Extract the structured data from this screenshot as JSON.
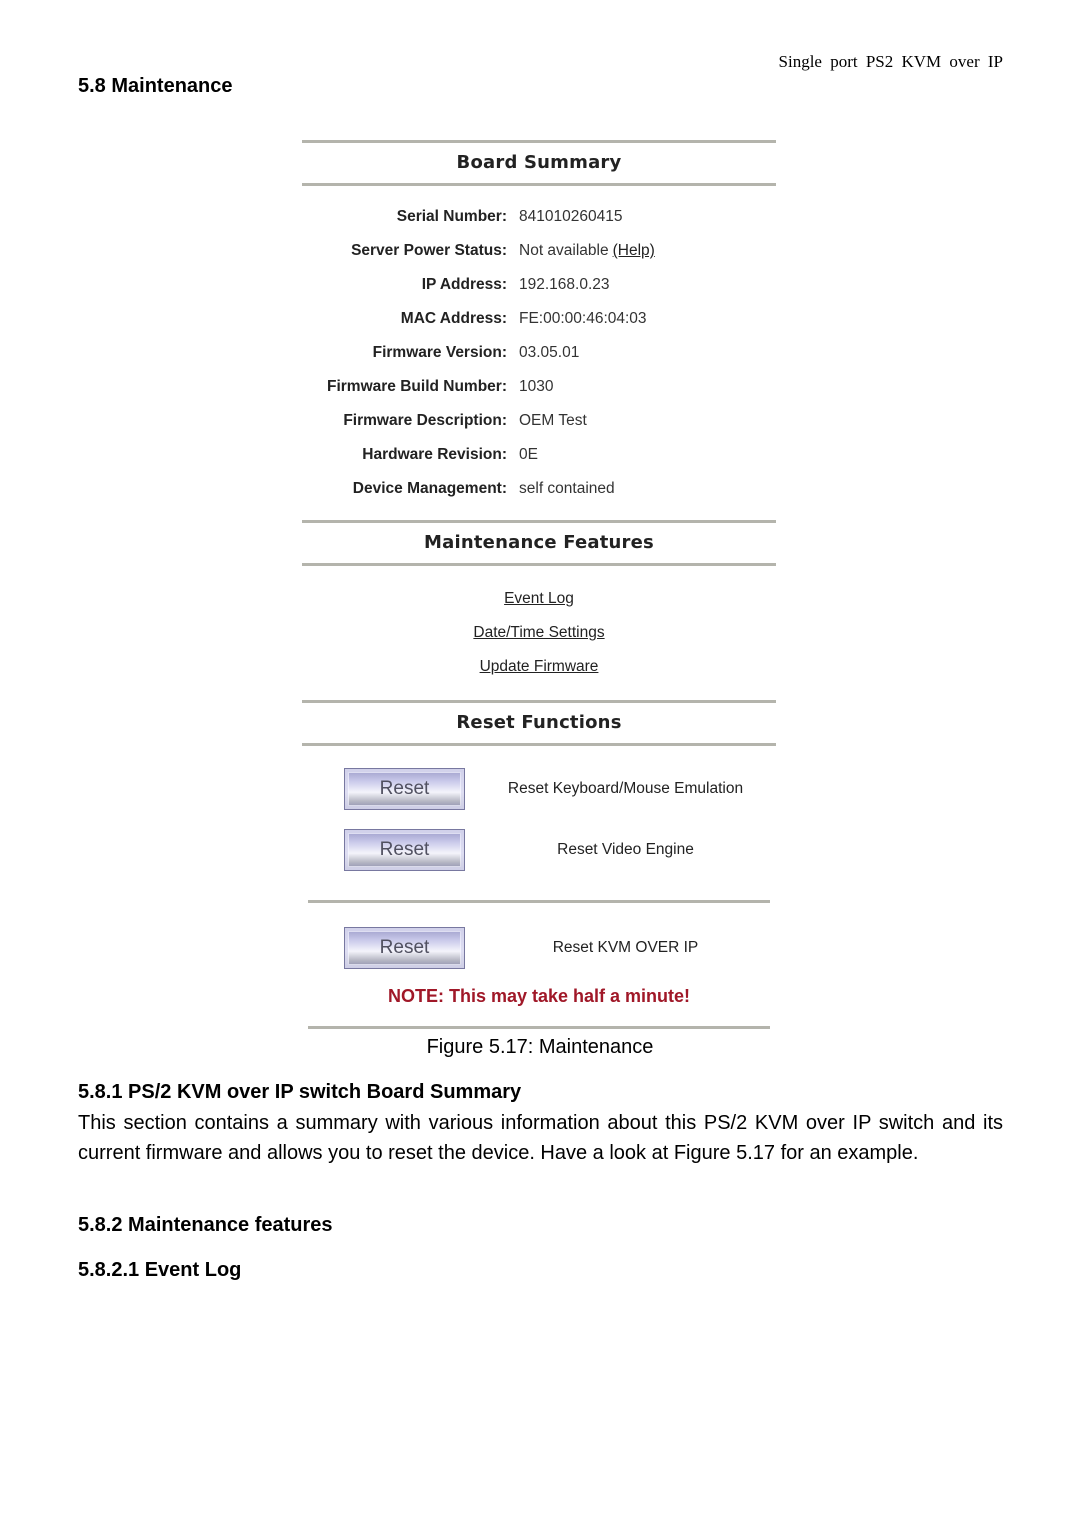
{
  "page": {
    "running_header": "Single port PS2 KVM over IP",
    "section_title": "5.8 Maintenance"
  },
  "figure": {
    "board_summary": {
      "heading": "Board Summary",
      "rows": [
        {
          "label": "Serial Number:",
          "value": "841010260415"
        },
        {
          "label": "Server Power Status:",
          "value": "Not available",
          "link": "(Help)"
        },
        {
          "label": "IP Address:",
          "value": "192.168.0.23"
        },
        {
          "label": "MAC Address:",
          "value": "FE:00:00:46:04:03"
        },
        {
          "label": "Firmware Version:",
          "value": "03.05.01"
        },
        {
          "label": "Firmware Build Number:",
          "value": "1030"
        },
        {
          "label": "Firmware Description:",
          "value": "OEM Test"
        },
        {
          "label": "Hardware Revision:",
          "value": "0E"
        },
        {
          "label": "Device Management:",
          "value": "self contained"
        }
      ]
    },
    "maintenance_features": {
      "heading": "Maintenance Features",
      "links": [
        "Event Log",
        "Date/Time Settings",
        "Update Firmware"
      ]
    },
    "reset_functions": {
      "heading": "Reset Functions",
      "items": [
        {
          "button": "Reset",
          "description": "Reset Keyboard/Mouse Emulation"
        },
        {
          "button": "Reset",
          "description": "Reset Video Engine"
        },
        {
          "button": "Reset",
          "description": "Reset KVM OVER IP"
        }
      ],
      "note": "NOTE: This may take half a minute!",
      "note_color": "#a01828"
    },
    "caption": "Figure 5.17: Maintenance"
  },
  "body": {
    "sub1_title": "5.8.1 PS/2 KVM over IP switch Board Summary",
    "sub1_text": "This section contains a summary with various information about this PS/2 KVM over IP switch and its current firmware and allows you to reset the device. Have a look at Figure 5.17 for an example.",
    "sub2_title": "5.8.2 Maintenance features",
    "sub3_title": "5.8.2.1 Event Log"
  }
}
